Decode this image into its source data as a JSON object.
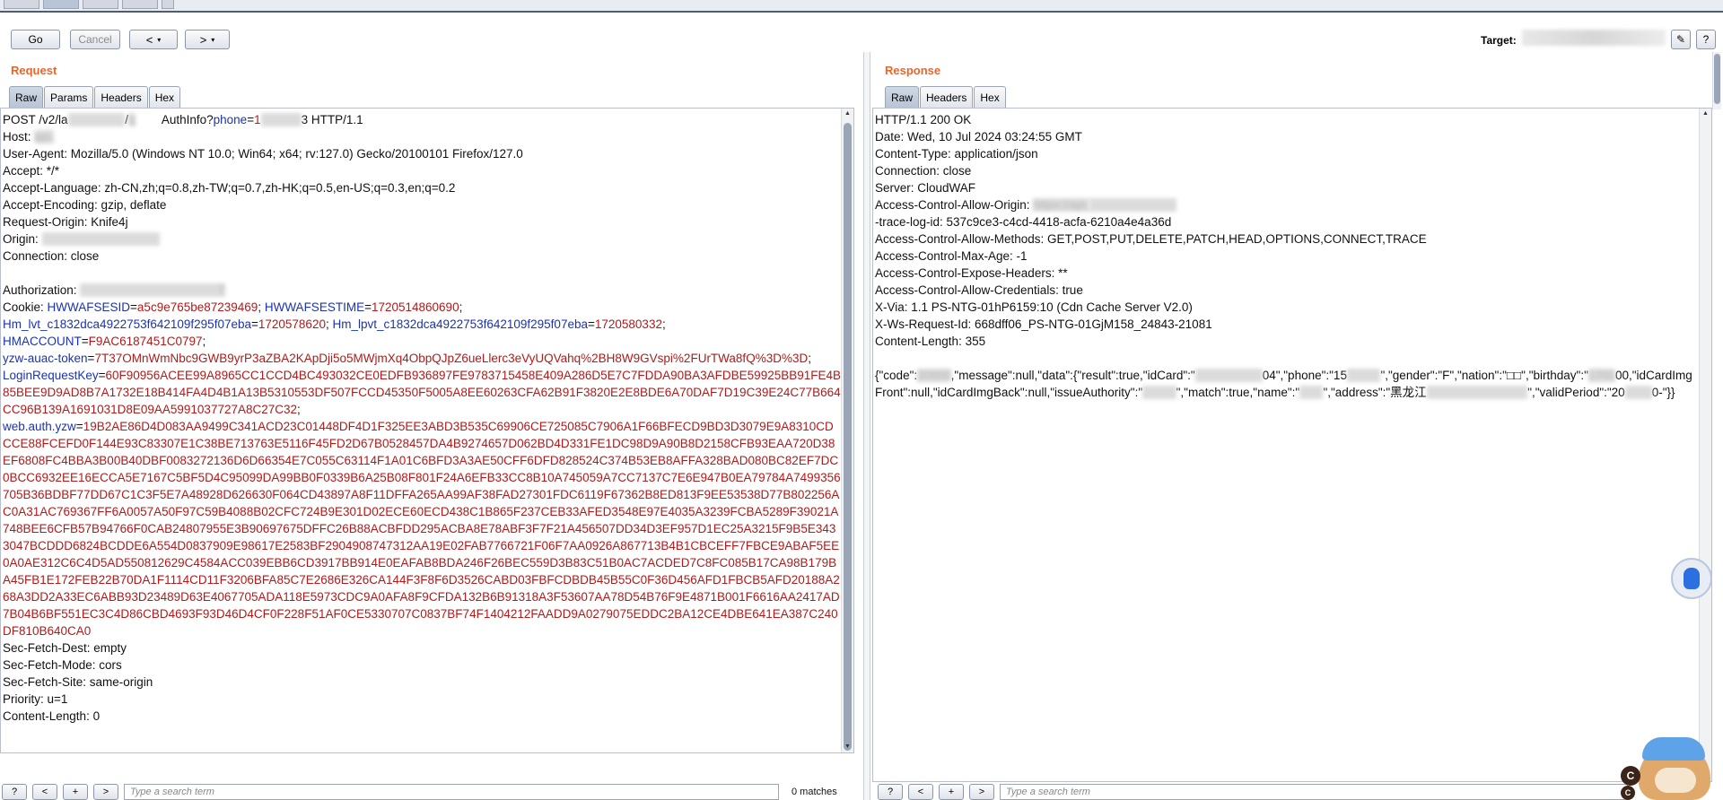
{
  "toolbar": {
    "go_label": "Go",
    "cancel_label": "Cancel",
    "back_label": "<",
    "forward_label": ">",
    "dropdown_glyph": "▾",
    "target_label": "Target:",
    "edit_icon": "✎",
    "help_icon": "?"
  },
  "request": {
    "title": "Request",
    "tabs": [
      "Raw",
      "Params",
      "Headers",
      "Hex"
    ],
    "active_tab": "Raw",
    "lines": [
      {
        "segs": [
          {
            "t": "POST /v2/la"
          },
          {
            "t": "                 ",
            "blur": true
          },
          {
            "t": "/"
          },
          {
            "t": "q",
            "blur": true
          },
          {
            "t": "        "
          },
          {
            "t": "AuthInfo?"
          },
          {
            "t": "phone",
            "c": "k"
          },
          {
            "t": "="
          },
          {
            "t": "1",
            "c": "v"
          },
          {
            "t": "            ",
            "blur": true
          },
          {
            "t": "3 HTTP/1.1"
          }
        ]
      },
      {
        "segs": [
          {
            "t": "Host: "
          },
          {
            "t": "api.",
            "blur": true
          }
        ]
      },
      {
        "segs": [
          {
            "t": "User-Agent: Mozilla/5.0 (Windows NT 10.0; Win64; x64; rv:127.0) Gecko/20100101 Firefox/127.0"
          }
        ]
      },
      {
        "segs": [
          {
            "t": "Accept: */*"
          }
        ]
      },
      {
        "segs": [
          {
            "t": "Accept-Language: zh-CN,zh;q=0.8,zh-TW;q=0.7,zh-HK;q=0.5,en-US;q=0.3,en;q=0.2"
          }
        ]
      },
      {
        "segs": [
          {
            "t": "Accept-Encoding: gzip, deflate"
          }
        ]
      },
      {
        "segs": [
          {
            "t": "Request-Origin: Knife4j"
          }
        ]
      },
      {
        "segs": [
          {
            "t": "Origin: "
          },
          {
            "t": "                                   ",
            "blur": true
          }
        ]
      },
      {
        "segs": [
          {
            "t": "Connection: close"
          }
        ]
      },
      {
        "segs": [
          {
            "t": " "
          }
        ]
      },
      {
        "segs": [
          {
            "t": "Authorization: "
          },
          {
            "t": "                                         7",
            "blur": true
          }
        ]
      },
      {
        "segs": [
          {
            "t": "Cookie: "
          },
          {
            "t": "HWWAFSESID",
            "c": "k"
          },
          {
            "t": "="
          },
          {
            "t": "a5c9e765be87239469",
            "c": "v"
          },
          {
            "t": "; "
          },
          {
            "t": "HWWAFSESTIME",
            "c": "k"
          },
          {
            "t": "="
          },
          {
            "t": "1720514860690",
            "c": "v"
          },
          {
            "t": ";"
          }
        ]
      },
      {
        "segs": [
          {
            "t": "Hm_lvt_c1832dca4922753f642109f295f07eba",
            "c": "k"
          },
          {
            "t": "="
          },
          {
            "t": "1720578620",
            "c": "v"
          },
          {
            "t": "; "
          },
          {
            "t": "Hm_lpvt_c1832dca4922753f642109f295f07eba",
            "c": "k"
          },
          {
            "t": "="
          },
          {
            "t": "1720580332",
            "c": "v"
          },
          {
            "t": ";"
          }
        ]
      },
      {
        "segs": [
          {
            "t": "HMACCOUNT",
            "c": "k"
          },
          {
            "t": "="
          },
          {
            "t": "F9AC6187451C0797",
            "c": "v"
          },
          {
            "t": ";"
          }
        ]
      },
      {
        "segs": [
          {
            "t": "yzw-auac-token",
            "c": "k"
          },
          {
            "t": "="
          },
          {
            "t": "7T37OMnWmNbc9GWB9yrP3aZBA2KApDji5o5MWjmXq4ObpQJpZ6ueLlerc3eVyUQVahq%2BH8W9GVspi%2FUrTWa8fQ%3D%3D",
            "c": "v"
          },
          {
            "t": ";"
          }
        ]
      },
      {
        "segs": [
          {
            "t": "LoginRequestKey",
            "c": "k"
          },
          {
            "t": "="
          },
          {
            "t": "60F90956ACEE99A8965CC1CCD4BC493032CE0EDFB936897FE9783715458E409A286D5E7C7FDDA90BA3AFDBE59925BB91FE4B85BEE9D9AD8B7A1732E18B414FA4D4B1A13B5310553DF507FCCD45350F5005A8EE60263CFA62B91F3820E2E8BDE6A70DAF7D19C39E24C77B664CC96B139A1691031D8E09AA5991037727A8C27C32",
            "c": "v"
          },
          {
            "t": ";"
          }
        ]
      },
      {
        "segs": [
          {
            "t": "web.auth.yzw",
            "c": "k"
          },
          {
            "t": "="
          },
          {
            "t": "19B2AE86D4D083AA9499C341ACD23C01448DF4D1F325EE3ABD3B535C69906CE725085C7906A1F66BFECD9BD3D3079E9A8310CDCCE88FCEFD0F144E93C83307E1C38BE713763E5116F45FD2D67B0528457DA4B9274657D062BD4D331FE1DC98D9A90B8D2158CFB93EAA720D38EF6808FC4BBA3B00B40DBF0083272136D6D66354E7C055C63114F1A01C6BFD3A3AE50CFF6DFD828524C374B53EB8AFFA328BAD080BC82EF7DC0BCC6932EE16ECCA5E7167C5BF5D4C95099DA99BB0F0339B6A25B08F801F24A6EFB33CC8B10A745059A7CC7137C7E6E947B0EA79784A7499356705B36BDBF77DD67C1C3F5E7A48928D626630F064CD43897A8F11DFFA265AA99AF38FAD27301FDC6119F67362B8ED813F9EE53538D77B802256AC0A31AC769367FF6A0057A50F97C59B4088B02CFC724B9E301D02ECE60ECD438C1B865F237CEB33AFED3548E97E4035A3239FCBA5289F39021A748BEE6CFB57B94766F0CAB24807955E3B90697675DFFC26B88ACBFDD295ACBA8E78ABF3F7F21A456507DD34D3EF957D1EC25A3215F9B5E3433047BCDDD6824BCDDE6A554D0837909E98617E2583BF2904908747312AA19E02FAB7766721F06F7AA0926A867713B4B1CBCEFF7FBCE9ABAF5EE0A0AE312C6C4D5AD550812629C4584ACC039EBB6CD3917BB914E0EAFAB8BDA246F26BEC559D3B83C51B0AC7ACDED7C8FC085B17CA98B179BA45FB1E172FEB22B70DA1F1114CD11F3206BFA85C7E2686E326CA144F3F8F6D3526CABD03FBFCDBDB45B55C0F36D456AFD1FBCB5AFD20188A268A3DD2A33EC6ABB93D23489D63E4067705ADA118E5973CDC9A0AFA8F9CFDA132B6B91318A3F53607AA78D54B76F9E4871B001F6616AA2417AD7B04B6BF551EC3C4D86CBD4693F93D46D4CF0F228F51AF0CE5330707C0837BF74F1404212FAADD9A0279075EDDC2BA12CE4DBE641EA387C240DF810B640CA0",
            "c": "v"
          }
        ]
      },
      {
        "segs": [
          {
            "t": "Sec-Fetch-Dest: empty"
          }
        ]
      },
      {
        "segs": [
          {
            "t": "Sec-Fetch-Mode: cors"
          }
        ]
      },
      {
        "segs": [
          {
            "t": "Sec-Fetch-Site: same-origin"
          }
        ]
      },
      {
        "segs": [
          {
            "t": "Priority: u=1"
          }
        ]
      },
      {
        "segs": [
          {
            "t": "Content-Length: 0"
          }
        ]
      }
    ],
    "search": {
      "help": "?",
      "prev": "<",
      "add": "+",
      "next": ">",
      "placeholder": "Type a search term",
      "matches": "0 matches"
    }
  },
  "response": {
    "title": "Response",
    "tabs": [
      "Raw",
      "Headers",
      "Hex"
    ],
    "active_tab": "Raw",
    "lines": [
      {
        "segs": [
          {
            "t": "HTTP/1.1 200 OK"
          }
        ]
      },
      {
        "segs": [
          {
            "t": "Date: Wed, 10 Jul 2024 03:24:55 GMT"
          }
        ]
      },
      {
        "segs": [
          {
            "t": "Content-Type: application/json"
          }
        ]
      },
      {
        "segs": [
          {
            "t": "Connection: close"
          }
        ]
      },
      {
        "segs": [
          {
            "t": "Server: CloudWAF"
          }
        ]
      },
      {
        "segs": [
          {
            "t": "Access-Control-Allow-Origin: "
          },
          {
            "t": "https://api.",
            "blur": true
          },
          {
            "t": "                          ",
            "blur": true
          }
        ]
      },
      {
        "segs": [
          {
            "t": "-trace-log-id: 537c9ce3-c4cd-4418-acfa-6210a4e4a36d"
          }
        ]
      },
      {
        "segs": [
          {
            "t": "Access-Control-Allow-Methods: GET,POST,PUT,DELETE,PATCH,HEAD,OPTIONS,CONNECT,TRACE"
          }
        ]
      },
      {
        "segs": [
          {
            "t": "Access-Control-Max-Age: -1"
          }
        ]
      },
      {
        "segs": [
          {
            "t": "Access-Control-Expose-Headers: **"
          }
        ]
      },
      {
        "segs": [
          {
            "t": "Access-Control-Allow-Credentials: true"
          }
        ]
      },
      {
        "segs": [
          {
            "t": "X-Via: 1.1 PS-NTG-01hP6159:10 (Cdn Cache Server V2.0)"
          }
        ]
      },
      {
        "segs": [
          {
            "t": "X-Ws-Request-Id: 668dff06_PS-NTG-01GjM158_24843-21081"
          }
        ]
      },
      {
        "segs": [
          {
            "t": "Content-Length: 355"
          }
        ]
      },
      {
        "segs": [
          {
            "t": " "
          }
        ]
      },
      {
        "segs": [
          {
            "t": "{\"code\":"
          },
          {
            "t": "20000",
            "blur": true
          },
          {
            "t": ",\"message\":null,\"data\":{\"result\":true,\"idCard\":\""
          },
          {
            "t": "                    ",
            "blur": true
          },
          {
            "t": "04\",\"phone\":\"15"
          },
          {
            "t": "          ",
            "blur": true
          },
          {
            "t": "\",\"gender\":\"F\",\"nation\":\"□□\",\"birthday\":\""
          },
          {
            "t": "1701",
            "blur": true
          },
          {
            "t": "00,\"idCardImgFront\":null,\"idCardImgBack\":null,\"issueAuthority\":\""
          },
          {
            "t": "          ",
            "blur": true
          },
          {
            "t": "\",\"match\":true,\"name\":\""
          },
          {
            "t": "       ",
            "blur": true
          },
          {
            "t": "\",\"address\":\"黑龙江"
          },
          {
            "t": "                              ",
            "blur": true
          },
          {
            "t": "\",\"validPeriod\":\"20"
          },
          {
            "t": "        ",
            "blur": true
          },
          {
            "t": "0-\"}}"
          }
        ]
      }
    ],
    "search": {
      "help": "?",
      "prev": "<",
      "add": "+",
      "next": ">",
      "placeholder": "Type a search term"
    }
  },
  "widgets": {
    "mascot_badge": "C"
  }
}
